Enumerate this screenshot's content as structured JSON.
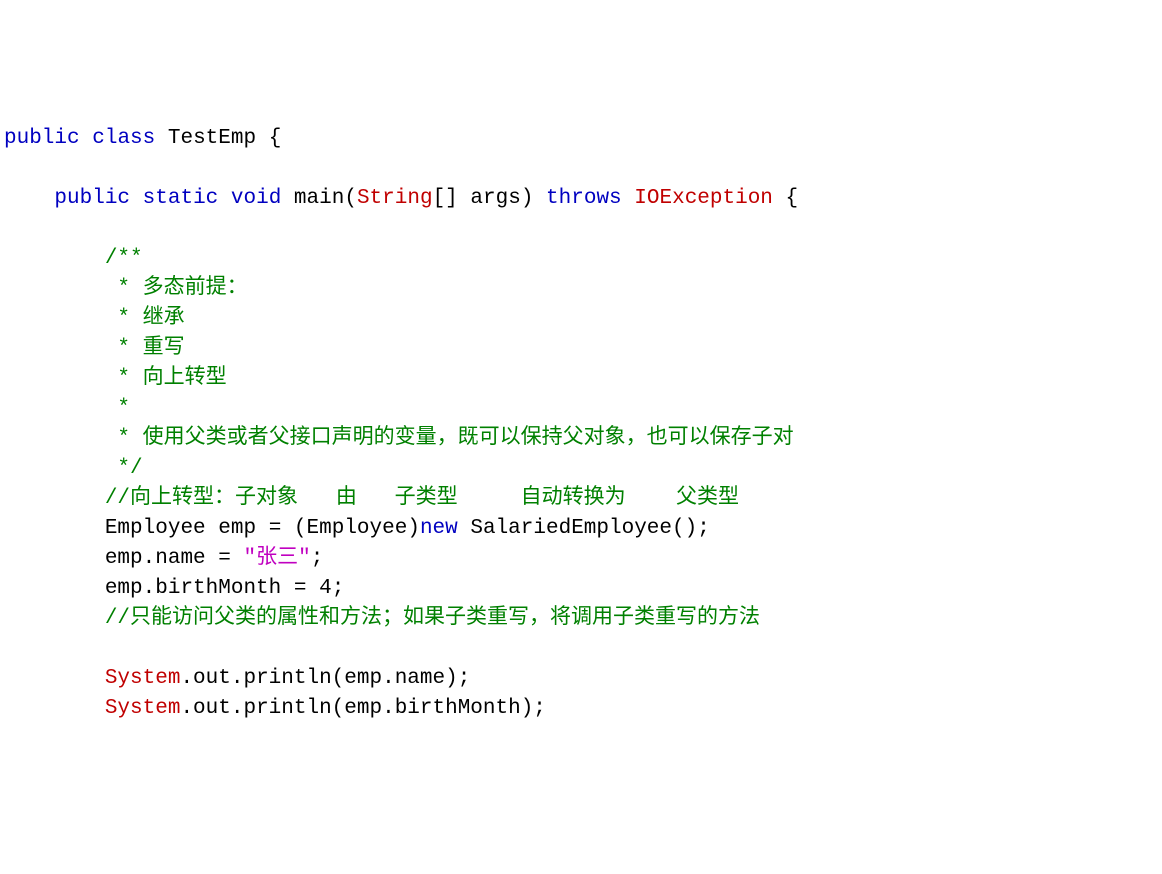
{
  "code": {
    "class_decl": {
      "public": "public",
      "class": "class",
      "name": "TestEmp",
      "lbrace": "{"
    },
    "main": {
      "public": "public",
      "static": "static",
      "void": "void",
      "main": "main",
      "lp": "(",
      "string": "String",
      "arr": "[]",
      "args": "args",
      "rp": ")",
      "throws": "throws",
      "io": "IOException",
      "lbrace": "{"
    },
    "doc": {
      "l1": "/**",
      "l2": " * 多态前提：",
      "l3": " * 继承",
      "l4": " * 重写",
      "l5": " * 向上转型",
      "l6": " * ",
      "l7": " * 使用父类或者父接口声明的变量，既可以保持父对象，也可以保存子对",
      "l8": " */"
    },
    "c1": "//向上转型：子对象   由   子类型     自动转换为    父类型",
    "s1": {
      "type1": "Employee",
      "id": "emp",
      "eq": "=",
      "lp": "(",
      "type2": "Employee",
      "rp": ")",
      "new": "new",
      "type3": "SalariedEmployee",
      "call": "()",
      ";": ";"
    },
    "s2": {
      "lhs": "emp.name",
      "eq": "=",
      "str": "\"张三\"",
      ";": ";"
    },
    "s3": {
      "lhs": "emp.birthMonth",
      "eq": "=",
      "val": "4",
      ";": ";"
    },
    "c2": "//只能访问父类的属性和方法；如果子类重写，将调用子类重写的方法",
    "p1": {
      "sys": "System",
      "rest": ".out.println(emp.name);"
    },
    "p2": {
      "sys": "System",
      "rest": ".out.println(emp.birthMonth);"
    }
  }
}
